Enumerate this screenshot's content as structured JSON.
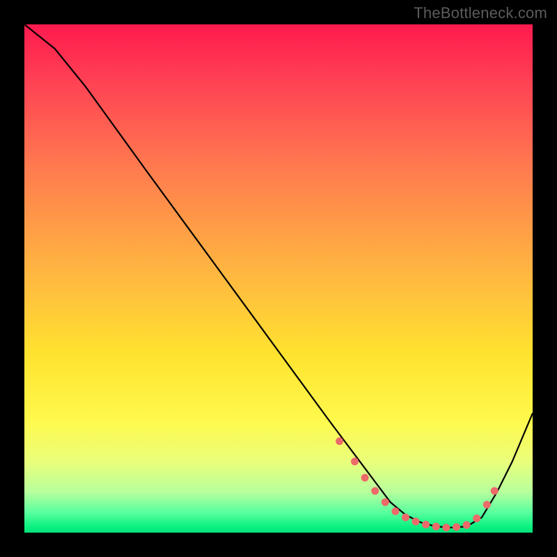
{
  "watermark": "TheBottleneck.com",
  "chart_data": {
    "type": "line",
    "title": "",
    "xlabel": "",
    "ylabel": "",
    "xlim": [
      0,
      100
    ],
    "ylim": [
      0,
      100
    ],
    "grid": false,
    "series": [
      {
        "name": "curve",
        "x": [
          0,
          6,
          12,
          18,
          24,
          30,
          36,
          42,
          48,
          54,
          60,
          63,
          66,
          69,
          72,
          75,
          78,
          81,
          84,
          87,
          90,
          93,
          96,
          100
        ],
        "y": [
          100,
          95.2,
          87.8,
          79.5,
          71.2,
          63.0,
          54.8,
          46.6,
          38.4,
          30.2,
          22.0,
          18.0,
          14.0,
          10.0,
          6.0,
          3.5,
          2.0,
          1.2,
          1.0,
          1.2,
          3.0,
          8.0,
          14.0,
          23.5
        ]
      }
    ],
    "markers": {
      "name": "highlight-dots",
      "color": "#ec6a6a",
      "x": [
        62,
        65,
        67,
        69,
        71,
        73,
        75,
        77,
        79,
        81,
        83,
        85,
        87,
        89,
        91,
        92.5
      ],
      "y": [
        18.0,
        14.0,
        10.8,
        8.2,
        6.0,
        4.2,
        3.0,
        2.2,
        1.6,
        1.2,
        1.0,
        1.1,
        1.5,
        2.8,
        5.5,
        8.2
      ]
    }
  }
}
